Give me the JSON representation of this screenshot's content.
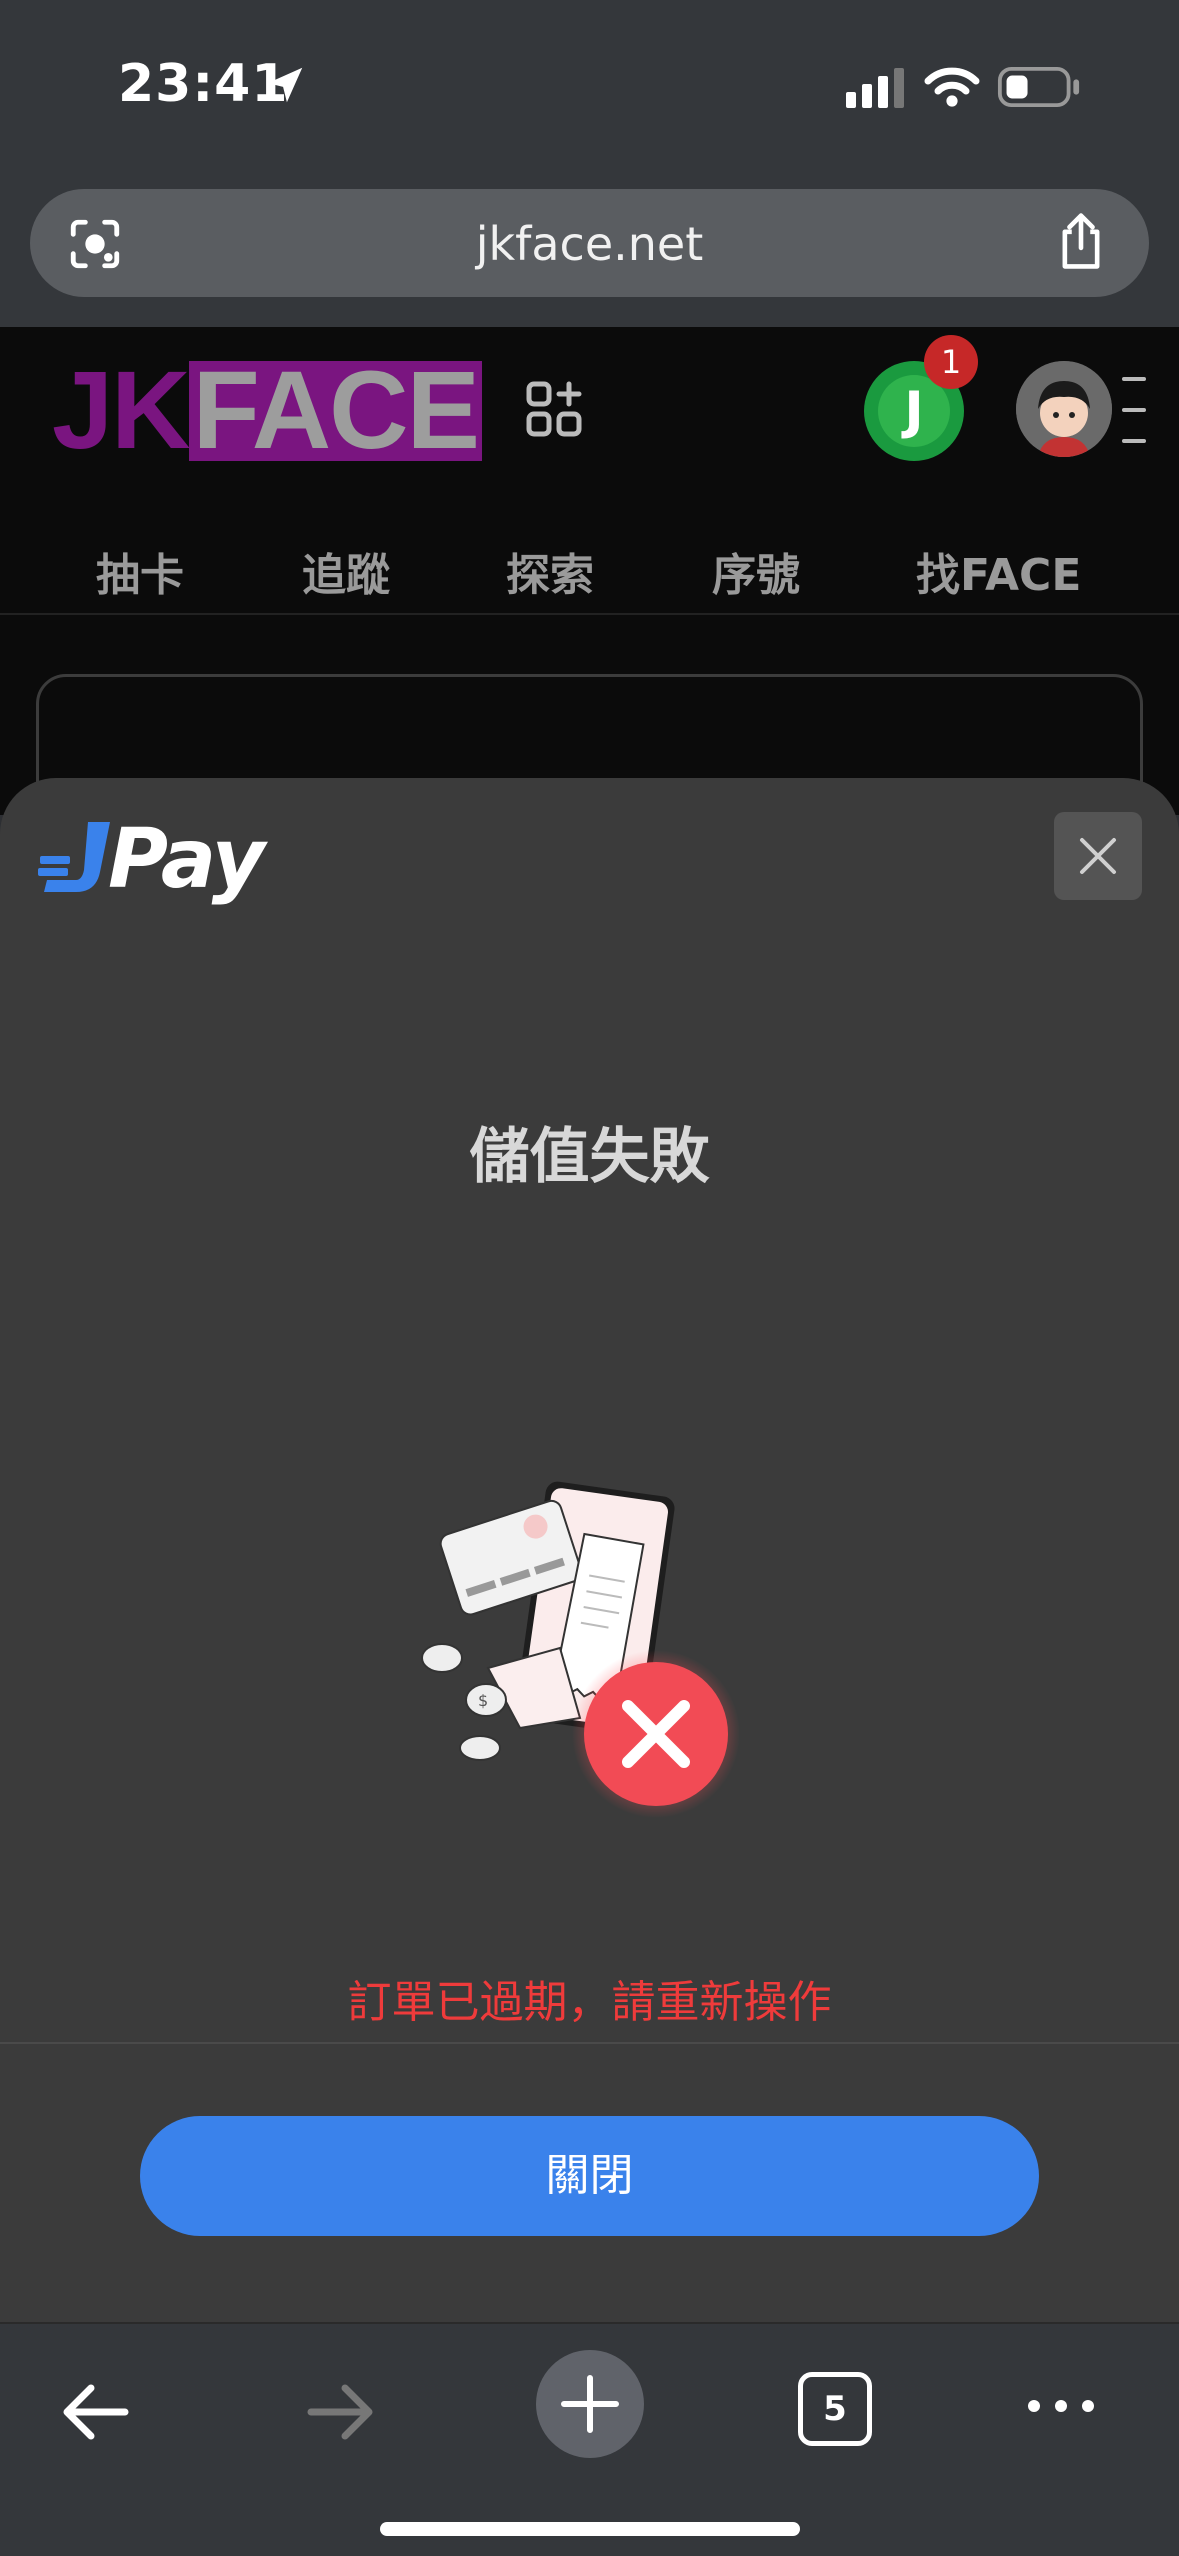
{
  "status_bar": {
    "time": "23:41",
    "icons": [
      "location-arrow-icon",
      "cell-signal-icon",
      "wifi-icon",
      "battery-icon"
    ]
  },
  "browser": {
    "url": "jkface.net",
    "tab_count": "5"
  },
  "site": {
    "logo_jk": "JK",
    "logo_face": "FACE",
    "notification_count": "1",
    "jpoint_letter": "J",
    "nav": [
      "抽卡",
      "追蹤",
      "探索",
      "序號",
      "找FACE"
    ]
  },
  "modal": {
    "brand": "Pay",
    "title": "儲值失敗",
    "error_message": "訂單已過期，請重新操作",
    "close_button": "關閉"
  },
  "colors": {
    "accent_blue": "#3a82eb",
    "error_red": "#ef3b3b",
    "brand_purple": "#7a1580"
  }
}
